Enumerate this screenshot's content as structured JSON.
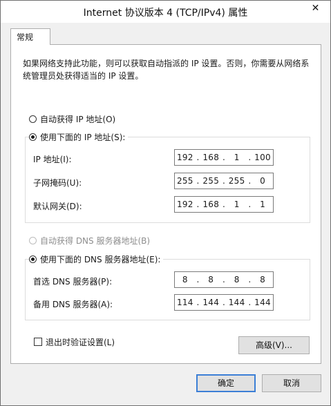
{
  "window": {
    "title": "Internet 协议版本 4 (TCP/IPv4) 属性",
    "close_glyph": "✕"
  },
  "tabs": [
    {
      "label": "常规"
    }
  ],
  "description": "如果网络支持此功能，则可以获取自动指派的 IP 设置。否则，你需要从网络系统管理员处获得适当的 IP 设置。",
  "ip_mode": {
    "auto_label": "自动获得 IP 地址(O)",
    "manual_label": "使用下面的 IP 地址(S):",
    "selected": "manual"
  },
  "ip_fields": [
    {
      "label": "IP 地址(I):",
      "octets": [
        "192",
        "168",
        "1",
        "100"
      ]
    },
    {
      "label": "子网掩码(U):",
      "octets": [
        "255",
        "255",
        "255",
        "0"
      ]
    },
    {
      "label": "默认网关(D):",
      "octets": [
        "192",
        "168",
        "1",
        "1"
      ]
    }
  ],
  "dns_mode": {
    "auto_label": "自动获得 DNS 服务器地址(B)",
    "manual_label": "使用下面的 DNS 服务器地址(E):",
    "selected": "manual",
    "auto_disabled": true
  },
  "dns_fields": [
    {
      "label": "首选 DNS 服务器(P):",
      "octets": [
        "8",
        "8",
        "8",
        "8"
      ]
    },
    {
      "label": "备用 DNS 服务器(A):",
      "octets": [
        "114",
        "144",
        "144",
        "144"
      ]
    }
  ],
  "validate_on_exit": {
    "label": "退出时验证设置(L)",
    "checked": false
  },
  "buttons": {
    "advanced": "高级(V)...",
    "ok": "确定",
    "cancel": "取消"
  },
  "colors": {
    "accent": "#3c7fd6",
    "disabled_text": "#8d8d8d"
  },
  "icons": {
    "close": "close-icon"
  }
}
